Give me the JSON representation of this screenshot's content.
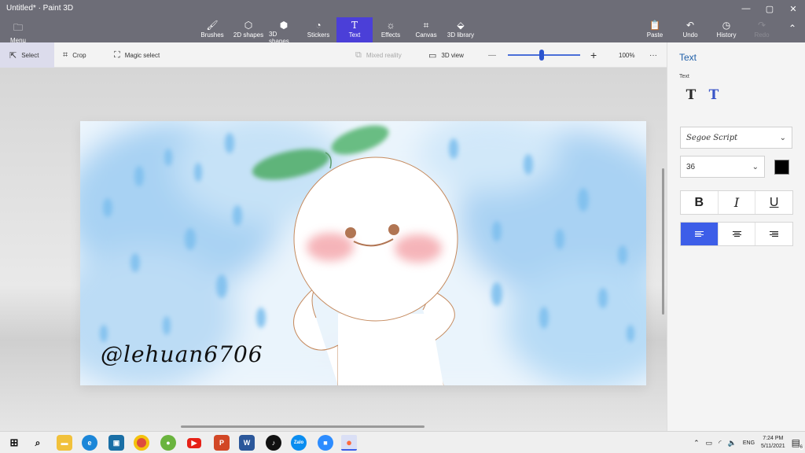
{
  "window": {
    "title": "Untitled* · Paint 3D",
    "minimize": "—",
    "maximize": "▢",
    "close": "✕"
  },
  "ribbon": {
    "menu_label": "Menu",
    "items": [
      {
        "label": "Brushes",
        "icon": "brush-icon"
      },
      {
        "label": "2D shapes",
        "icon": "shapes-2d-icon"
      },
      {
        "label": "3D shapes",
        "icon": "cube-icon"
      },
      {
        "label": "Stickers",
        "icon": "sticker-icon"
      },
      {
        "label": "Text",
        "icon": "text-icon"
      },
      {
        "label": "Effects",
        "icon": "effects-icon"
      },
      {
        "label": "Canvas",
        "icon": "canvas-icon"
      },
      {
        "label": "3D library",
        "icon": "library-3d-icon"
      }
    ],
    "paste_label": "Paste",
    "undo_label": "Undo",
    "history_label": "History",
    "redo_label": "Redo"
  },
  "toolbar": {
    "select_label": "Select",
    "crop_label": "Crop",
    "magic_select_label": "Magic select",
    "mixed_reality_label": "Mixed reality",
    "view3d_label": "3D view",
    "zoom_out": "—",
    "zoom_in": "+",
    "zoom_value": "100%",
    "zoom_fraction": 0.47,
    "more": "···"
  },
  "canvas": {
    "watermark_text": "@lehuan6706"
  },
  "sidepanel": {
    "title": "Text",
    "section_label": "Text",
    "font_family": "Segoe Script",
    "font_size": "36",
    "text_color": "#000000",
    "bold": "B",
    "italic": "I",
    "underline": "U"
  },
  "taskbar": {
    "lang": "ENG",
    "time": "7:24 PM",
    "date": "5/11/2021",
    "notifications": "6",
    "apps": [
      "windows-start-icon",
      "search-icon",
      "file-explorer-icon",
      "edge-icon",
      "dell-icon",
      "chrome-icon",
      "coccoc-icon",
      "youtube-icon",
      "powerpoint-icon",
      "word-icon",
      "tiktok-icon",
      "zalo-icon",
      "zoom-icon",
      "paint3d-icon"
    ]
  },
  "colors": {
    "accent": "#4b3fd8",
    "active_align": "#3d5ee8",
    "title_blue": "#1f5fa8"
  }
}
